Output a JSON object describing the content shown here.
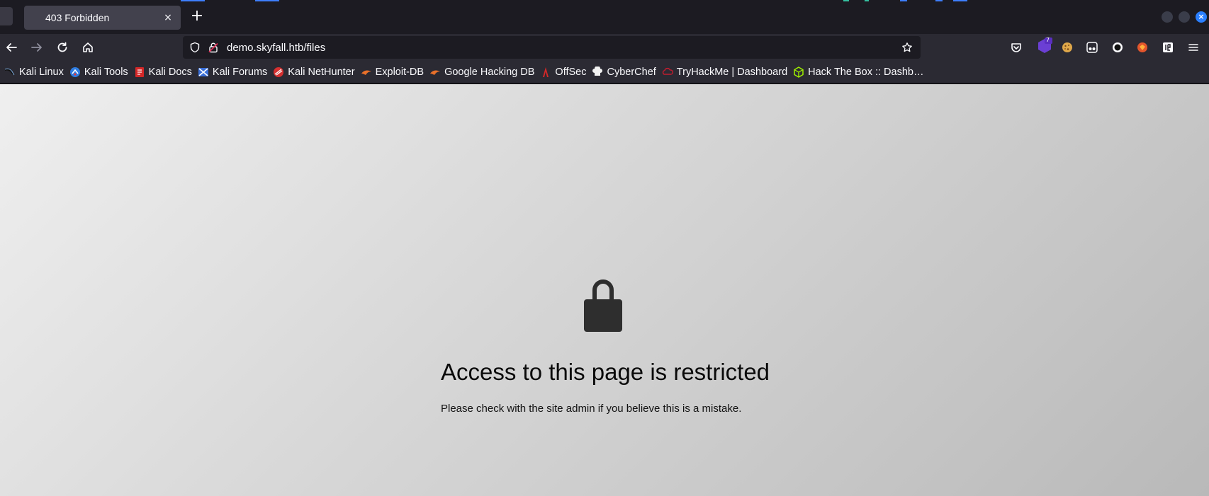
{
  "tab": {
    "title": "403 Forbidden",
    "close_glyph": "×"
  },
  "new_tab_glyph": "+",
  "window_close_glyph": "×",
  "urlbar": {
    "url": "demo.skyfall.htb/files"
  },
  "extensions": {
    "badge_count": "7"
  },
  "bookmarks": [
    {
      "label": "Kali Linux",
      "icon": "kali-dragon-icon"
    },
    {
      "label": "Kali Tools",
      "icon": "kali-tools-icon"
    },
    {
      "label": "Kali Docs",
      "icon": "kali-docs-icon"
    },
    {
      "label": "Kali Forums",
      "icon": "kali-forums-icon"
    },
    {
      "label": "Kali NetHunter",
      "icon": "nethunter-icon"
    },
    {
      "label": "Exploit-DB",
      "icon": "exploit-db-icon"
    },
    {
      "label": "Google Hacking DB",
      "icon": "ghdb-icon"
    },
    {
      "label": "OffSec",
      "icon": "offsec-icon"
    },
    {
      "label": "CyberChef",
      "icon": "cyberchef-icon"
    },
    {
      "label": "TryHackMe | Dashboard",
      "icon": "tryhackme-icon"
    },
    {
      "label": "Hack The Box :: Dashb…",
      "icon": "hackthebox-icon"
    }
  ],
  "page": {
    "title": "Access to this page is restricted",
    "message": "Please check with the site admin if you believe this is a mistake."
  },
  "colors": {
    "tabstrip_bg": "#1c1b22",
    "toolbar_bg": "#2b2a33",
    "accent": "#3d7eff",
    "lock": "#2e2e2e"
  }
}
